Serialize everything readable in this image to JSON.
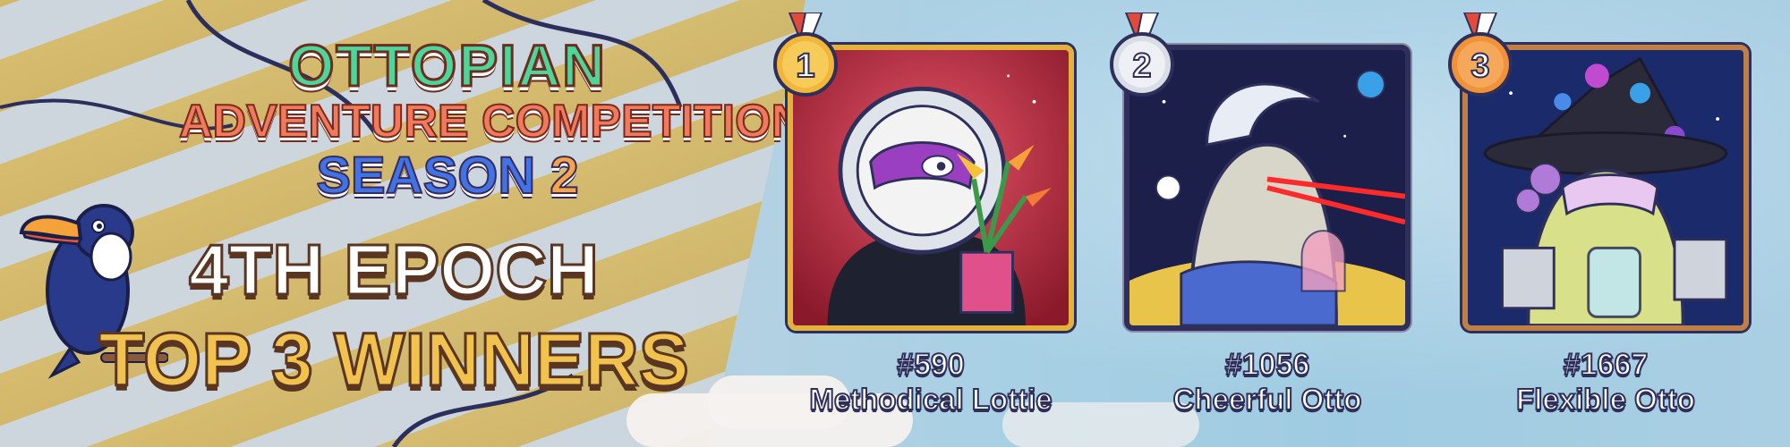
{
  "title": {
    "line1": "OTTOPIAN",
    "line2": "ADVENTURE COMPETITION",
    "line3_word": "SEASON",
    "line3_num": "2"
  },
  "headline": {
    "epoch": "4TH EPOCH",
    "winners": "TOP 3 WINNERS"
  },
  "winners": [
    {
      "rank": "1",
      "id": "#590",
      "name": "Methodical Lottie",
      "medal_color": "#f2b73a"
    },
    {
      "rank": "2",
      "id": "#1056",
      "name": "Cheerful Otto",
      "medal_color": "#d9dde6"
    },
    {
      "rank": "3",
      "id": "#1667",
      "name": "Flexible Otto",
      "medal_color": "#f0923a"
    }
  ],
  "colors": {
    "gold": "#e2b23c",
    "silver": "#c8ccd8",
    "bronze": "#c07f47",
    "outline": "#2e2f5a"
  }
}
